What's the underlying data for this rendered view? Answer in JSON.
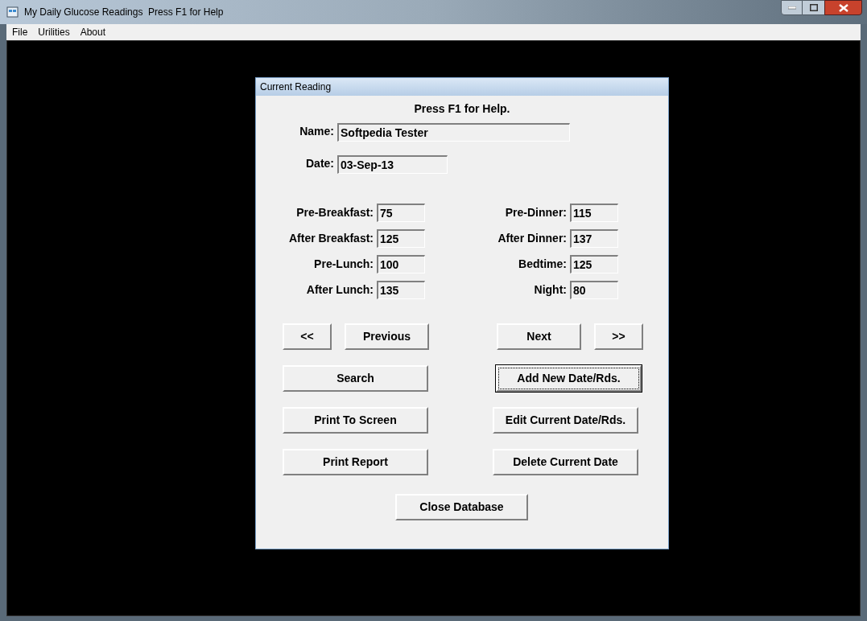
{
  "window": {
    "title": "My Daily Glucose Readings  Press F1 for Help"
  },
  "menu": [
    "File",
    "Urilities",
    "About"
  ],
  "dialog": {
    "title": "Current Reading",
    "help": "Press F1 for Help.",
    "name": {
      "label": "Name:",
      "value": "Softpedia Tester"
    },
    "date": {
      "label": "Date:",
      "value": "03-Sep-13"
    },
    "readings_left": [
      {
        "label": "Pre-Breakfast:",
        "value": "75"
      },
      {
        "label": "After Breakfast:",
        "value": "125"
      },
      {
        "label": "Pre-Lunch:",
        "value": "100"
      },
      {
        "label": "After Lunch:",
        "value": "135"
      }
    ],
    "readings_right": [
      {
        "label": "Pre-Dinner:",
        "value": "115"
      },
      {
        "label": "After Dinner:",
        "value": "137"
      },
      {
        "label": "Bedtime:",
        "value": "125"
      },
      {
        "label": "Night:",
        "value": "80"
      }
    ],
    "buttons": [
      {
        "label": "<<",
        "focused": false
      },
      {
        "label": "Previous",
        "focused": false
      },
      {
        "label": "Next",
        "focused": false
      },
      {
        "label": ">>",
        "focused": false
      },
      {
        "label": "Search",
        "focused": false
      },
      {
        "label": "Add New Date/Rds.",
        "focused": true
      },
      {
        "label": "Print To Screen",
        "focused": false
      },
      {
        "label": "Edit Current Date/Rds.",
        "focused": false
      },
      {
        "label": "Print Report",
        "focused": false
      },
      {
        "label": "Delete Current Date",
        "focused": false
      },
      {
        "label": "Close Database",
        "focused": false
      }
    ]
  }
}
